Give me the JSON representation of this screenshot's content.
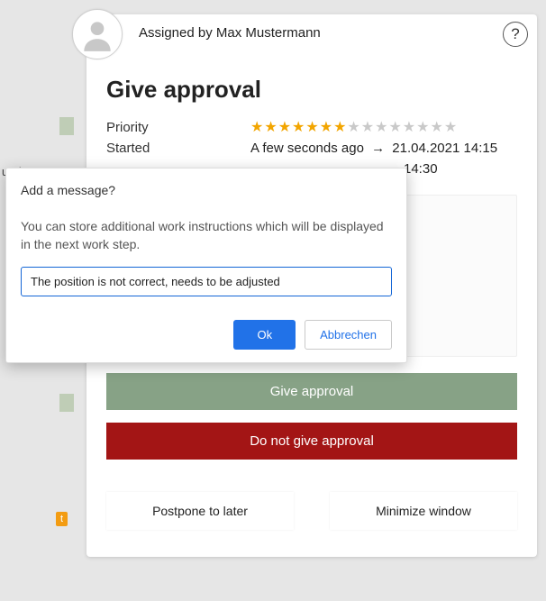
{
  "header": {
    "assigned_by": "Assigned by Max Mustermann",
    "help_glyph": "?"
  },
  "panel": {
    "title": "Give approval",
    "priority_label": "Priority",
    "priority_filled": 7,
    "priority_total": 15,
    "started_label": "Started",
    "started_value": "A few seconds ago",
    "arrow": "→",
    "started_target": "21.04.2021 14:15",
    "second_target": "14:30"
  },
  "actions": {
    "approve": "Give approval",
    "reject": "Do not give approval",
    "postpone": "Postpone to later",
    "minimize": "Minimize window"
  },
  "dialog": {
    "title": "Add a message?",
    "body": "You can store additional work instructions which will be displayed in the next work step.",
    "input_value": "The position is not correct, needs to be adjusted",
    "ok": "Ok",
    "cancel": "Abbrechen"
  },
  "background": {
    "badge": "t",
    "tab_fragment": "unde"
  }
}
